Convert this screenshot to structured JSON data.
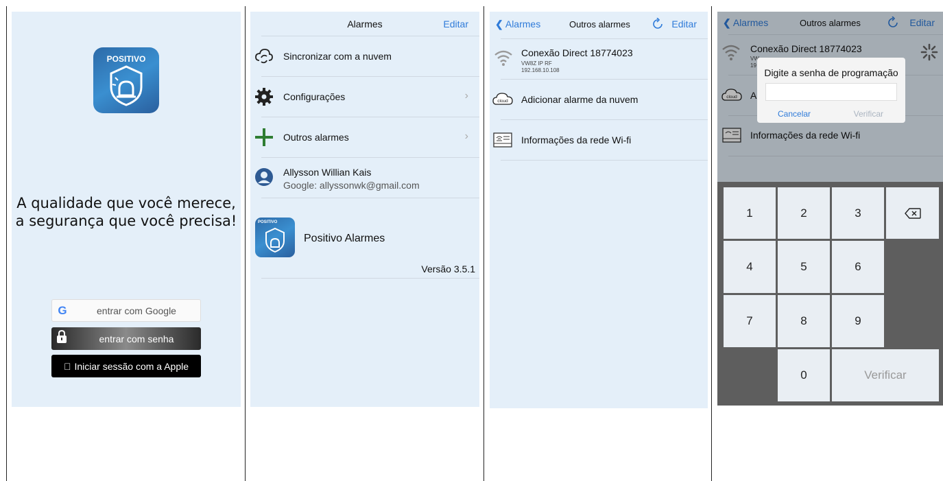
{
  "screen1": {
    "logo_brand": "POSITIVO",
    "tagline_line1": "A qualidade que você merece,",
    "tagline_line2": "a segurança que você precisa!",
    "google_button": "entrar com Google",
    "senha_button": "entrar com senha",
    "apple_button": "Iniciar sessão com a Apple"
  },
  "screen2": {
    "title": "Alarmes",
    "edit": "Editar",
    "items": [
      {
        "label": "Sincronizar com a nuvem",
        "icon": "cloud-sync-icon"
      },
      {
        "label": "Configurações",
        "icon": "gear-icon"
      },
      {
        "label": "Outros alarmes",
        "icon": "plus-icon"
      }
    ],
    "user_name": "Allysson Willian Kais",
    "user_email": "Google: allyssonwk@gmail.com",
    "app_brand": "POSITIVO",
    "app_name": "Positivo Alarmes",
    "version": "Versão 3.5.1"
  },
  "screen3": {
    "back": "Alarmes",
    "title": "Outros alarmes",
    "edit": "Editar",
    "device_name": "Conexão Direct 18774023",
    "device_model": "VW8Z IP RF",
    "device_ip": "192.168.10.108",
    "cloud_label": "cloud",
    "add_cloud": "Adicionar alarme da nuvem",
    "wifi_info": "Informações da rede Wi-fi"
  },
  "screen4": {
    "back": "Alarmes",
    "title": "Outros alarmes",
    "edit": "Editar",
    "device_name": "Conexão Direct 18774023",
    "device_model_partial": "VW",
    "device_ip_partial": "19",
    "cloud_label": "cloud",
    "add_cloud_partial": "A",
    "wifi_info": "Informações da rede Wi-fi",
    "dialog_title": "Digite a senha de programação",
    "dialog_cancel": "Cancelar",
    "dialog_verify": "Verificar",
    "keys": [
      "1",
      "2",
      "3",
      "4",
      "5",
      "6",
      "7",
      "8",
      "9",
      "0"
    ],
    "verify_key": "Verificar"
  },
  "colors": {
    "accent": "#2f7bd9",
    "background": "#e4eff9",
    "keypad": "#5e5e5e"
  }
}
